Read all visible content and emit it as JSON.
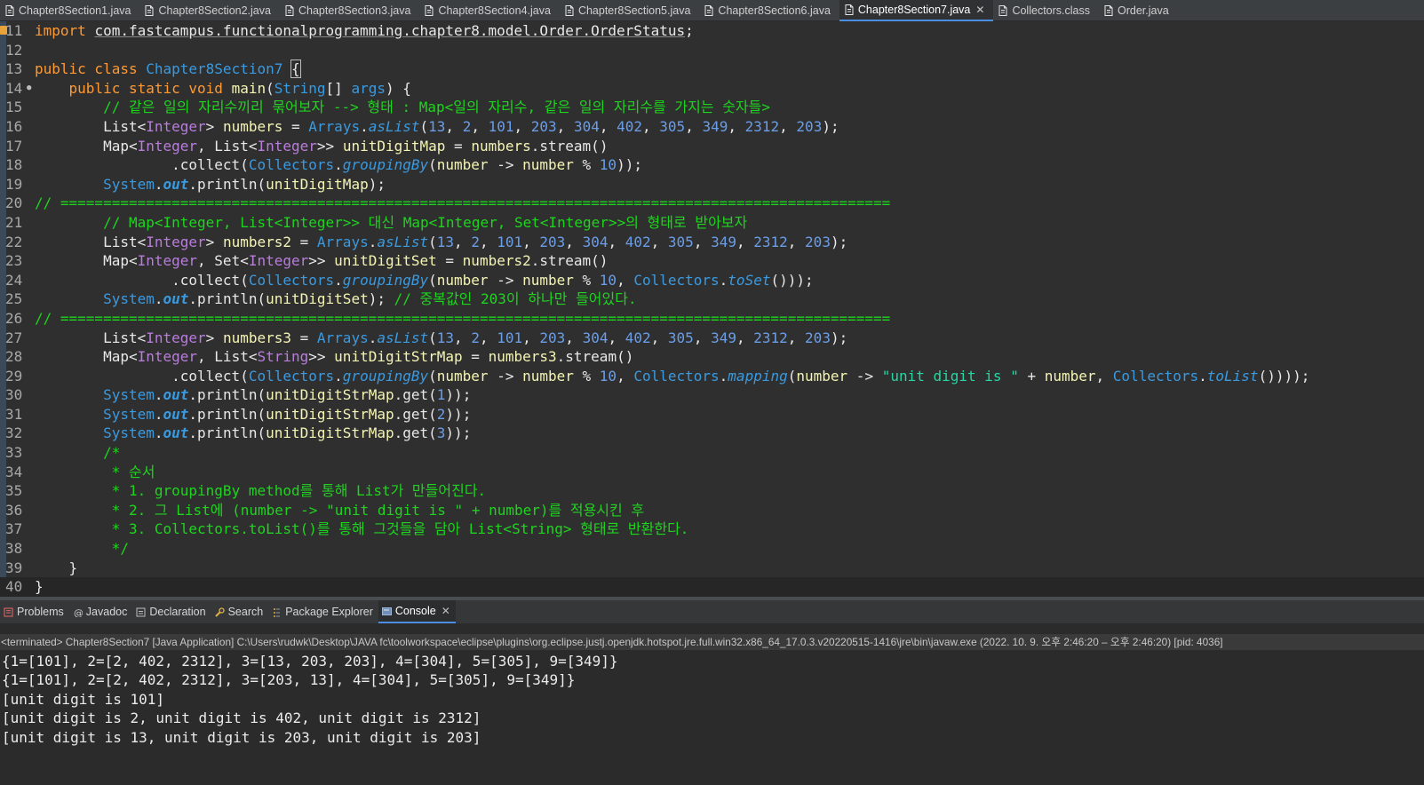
{
  "tabs": [
    {
      "label": "Chapter8Section1.java",
      "icon": "java-file-icon",
      "active": false
    },
    {
      "label": "Chapter8Section2.java",
      "icon": "java-file-icon",
      "active": false
    },
    {
      "label": "Chapter8Section3.java",
      "icon": "java-file-icon",
      "active": false
    },
    {
      "label": "Chapter8Section4.java",
      "icon": "java-file-icon",
      "active": false
    },
    {
      "label": "Chapter8Section5.java",
      "icon": "java-file-icon",
      "active": false
    },
    {
      "label": "Chapter8Section6.java",
      "icon": "java-file-icon",
      "active": false
    },
    {
      "label": "Chapter8Section7.java",
      "icon": "java-file-icon",
      "active": true,
      "close": "✕"
    },
    {
      "label": "Collectors.class",
      "icon": "class-file-icon",
      "active": false
    },
    {
      "label": "Order.java",
      "icon": "java-file-icon",
      "active": false
    }
  ],
  "editor": {
    "line_numbers": [
      "11",
      "12",
      "13",
      "14",
      "15",
      "16",
      "17",
      "18",
      "19",
      "20",
      "21",
      "22",
      "23",
      "24",
      "25",
      "26",
      "27",
      "28",
      "29",
      "30",
      "31",
      "32",
      "33",
      "34",
      "35",
      "36",
      "37",
      "38",
      "39",
      "40"
    ],
    "scroll_left_arrow": "<"
  },
  "panel": {
    "tabs": [
      {
        "label": "Problems",
        "icon": "problems-icon",
        "active": false
      },
      {
        "label": "Javadoc",
        "icon": "javadoc-icon",
        "active": false
      },
      {
        "label": "Declaration",
        "icon": "declaration-icon",
        "active": false
      },
      {
        "label": "Search",
        "icon": "search-icon",
        "active": false
      },
      {
        "label": "Package Explorer",
        "icon": "package-explorer-icon",
        "active": false
      },
      {
        "label": "Console",
        "icon": "console-icon",
        "active": true,
        "close": "✕"
      }
    ]
  },
  "console": {
    "header": "<terminated> Chapter8Section7 [Java Application] C:\\Users\\rudwk\\Desktop\\JAVA fc\\toolworkspace\\eclipse\\plugins\\org.eclipse.justj.openjdk.hotspot.jre.full.win32.x86_64_17.0.3.v20220515-1416\\jre\\bin\\javaw.exe  (2022. 10. 9. 오후 2:46:20 – 오후 2:46:20) [pid: 4036]",
    "output": [
      "{1=[101], 2=[2, 402, 2312], 3=[13, 203, 203], 4=[304], 5=[305], 9=[349]}",
      "{1=[101], 2=[2, 402, 2312], 3=[203, 13], 4=[304], 5=[305], 9=[349]}",
      "[unit digit is 101]",
      "[unit digit is 2, unit digit is 402, unit digit is 2312]",
      "[unit digit is 13, unit digit is 203, unit digit is 203]"
    ]
  },
  "code_lines": [
    [
      [
        "kw",
        "import "
      ],
      [
        "u",
        "com.fastcampus.functionalprogramming.chapter8.model.Order.OrderStatus"
      ],
      [
        "",
        "; "
      ]
    ],
    [],
    [
      [
        "kw",
        "public class "
      ],
      [
        "cls",
        "Chapter8Section7"
      ],
      [
        "",
        " "
      ],
      [
        "boxed",
        "{"
      ]
    ],
    [
      [
        "",
        "    "
      ],
      [
        "kw",
        "public static void "
      ],
      [
        "var",
        "main"
      ],
      [
        "",
        "("
      ],
      [
        "cls",
        "String"
      ],
      [
        "",
        "[] "
      ],
      [
        "cls",
        "args"
      ],
      [
        "",
        ") {"
      ]
    ],
    [
      [
        "",
        "        "
      ],
      [
        "cm",
        "// 같은 일의 자리수끼리 묶어보자 --> 형태 : Map<일의 자리수, 같은 일의 자리수를 가지는 숫자들>"
      ]
    ],
    [
      [
        "",
        "        List<"
      ],
      [
        "typ",
        "Integer"
      ],
      [
        "",
        "> "
      ],
      [
        "var",
        "numbers"
      ],
      [
        "",
        " = "
      ],
      [
        "cls",
        "Arrays"
      ],
      [
        "",
        "."
      ],
      [
        "cls it",
        "asList"
      ],
      [
        "",
        "("
      ],
      [
        "num",
        "13"
      ],
      [
        "",
        ", "
      ],
      [
        "num",
        "2"
      ],
      [
        "",
        ", "
      ],
      [
        "num",
        "101"
      ],
      [
        "",
        ", "
      ],
      [
        "num",
        "203"
      ],
      [
        "",
        ", "
      ],
      [
        "num",
        "304"
      ],
      [
        "",
        ", "
      ],
      [
        "num",
        "402"
      ],
      [
        "",
        ", "
      ],
      [
        "num",
        "305"
      ],
      [
        "",
        ", "
      ],
      [
        "num",
        "349"
      ],
      [
        "",
        ", "
      ],
      [
        "num",
        "2312"
      ],
      [
        "",
        ", "
      ],
      [
        "num",
        "203"
      ],
      [
        "",
        ");"
      ]
    ],
    [
      [
        "",
        "        Map<"
      ],
      [
        "typ",
        "Integer"
      ],
      [
        "",
        ", List<"
      ],
      [
        "typ",
        "Integer"
      ],
      [
        "",
        ">> "
      ],
      [
        "var",
        "unitDigitMap"
      ],
      [
        "",
        " = "
      ],
      [
        "var",
        "numbers"
      ],
      [
        "",
        ".stream()"
      ]
    ],
    [
      [
        "",
        "                .collect("
      ],
      [
        "cls",
        "Collectors"
      ],
      [
        "",
        "."
      ],
      [
        "cls it",
        "groupingBy"
      ],
      [
        "",
        "("
      ],
      [
        "var",
        "number"
      ],
      [
        "",
        " -> "
      ],
      [
        "var",
        "number"
      ],
      [
        "",
        " % "
      ],
      [
        "num",
        "10"
      ],
      [
        "",
        "));"
      ]
    ],
    [
      [
        "",
        "        "
      ],
      [
        "cls",
        "System"
      ],
      [
        "",
        "."
      ],
      [
        "cls it bold",
        "out"
      ],
      [
        "",
        ".println("
      ],
      [
        "var",
        "unitDigitMap"
      ],
      [
        "",
        ");"
      ]
    ],
    [
      [
        "cm",
        "// ================================================================================================="
      ]
    ],
    [
      [
        "",
        "        "
      ],
      [
        "cm",
        "// Map<Integer, List<Integer>> 대신 Map<Integer, Set<Integer>>의 형태로 받아보자"
      ]
    ],
    [
      [
        "",
        "        List<"
      ],
      [
        "typ",
        "Integer"
      ],
      [
        "",
        "> "
      ],
      [
        "var",
        "numbers2"
      ],
      [
        "",
        " = "
      ],
      [
        "cls",
        "Arrays"
      ],
      [
        "",
        "."
      ],
      [
        "cls it",
        "asList"
      ],
      [
        "",
        "("
      ],
      [
        "num",
        "13"
      ],
      [
        "",
        ", "
      ],
      [
        "num",
        "2"
      ],
      [
        "",
        ", "
      ],
      [
        "num",
        "101"
      ],
      [
        "",
        ", "
      ],
      [
        "num",
        "203"
      ],
      [
        "",
        ", "
      ],
      [
        "num",
        "304"
      ],
      [
        "",
        ", "
      ],
      [
        "num",
        "402"
      ],
      [
        "",
        ", "
      ],
      [
        "num",
        "305"
      ],
      [
        "",
        ", "
      ],
      [
        "num",
        "349"
      ],
      [
        "",
        ", "
      ],
      [
        "num",
        "2312"
      ],
      [
        "",
        ", "
      ],
      [
        "num",
        "203"
      ],
      [
        "",
        ");"
      ]
    ],
    [
      [
        "",
        "        Map<"
      ],
      [
        "typ",
        "Integer"
      ],
      [
        "",
        ", Set<"
      ],
      [
        "typ",
        "Integer"
      ],
      [
        "",
        ">> "
      ],
      [
        "var",
        "unitDigitSet"
      ],
      [
        "",
        " = "
      ],
      [
        "var",
        "numbers2"
      ],
      [
        "",
        ".stream()"
      ]
    ],
    [
      [
        "",
        "                .collect("
      ],
      [
        "cls",
        "Collectors"
      ],
      [
        "",
        "."
      ],
      [
        "cls it",
        "groupingBy"
      ],
      [
        "",
        "("
      ],
      [
        "var",
        "number"
      ],
      [
        "",
        " -> "
      ],
      [
        "var",
        "number"
      ],
      [
        "",
        " % "
      ],
      [
        "num",
        "10"
      ],
      [
        "",
        ", "
      ],
      [
        "cls",
        "Collectors"
      ],
      [
        "",
        "."
      ],
      [
        "cls it",
        "toSet"
      ],
      [
        "",
        "()));"
      ]
    ],
    [
      [
        "",
        "        "
      ],
      [
        "cls",
        "System"
      ],
      [
        "",
        "."
      ],
      [
        "cls it bold",
        "out"
      ],
      [
        "",
        ".println("
      ],
      [
        "var",
        "unitDigitSet"
      ],
      [
        "",
        "); "
      ],
      [
        "cm",
        "// 중복값인 203이 하나만 들어있다."
      ]
    ],
    [
      [
        "cm",
        "// ================================================================================================="
      ]
    ],
    [
      [
        "",
        "        List<"
      ],
      [
        "typ",
        "Integer"
      ],
      [
        "",
        "> "
      ],
      [
        "var",
        "numbers3"
      ],
      [
        "",
        " = "
      ],
      [
        "cls",
        "Arrays"
      ],
      [
        "",
        "."
      ],
      [
        "cls it",
        "asList"
      ],
      [
        "",
        "("
      ],
      [
        "num",
        "13"
      ],
      [
        "",
        ", "
      ],
      [
        "num",
        "2"
      ],
      [
        "",
        ", "
      ],
      [
        "num",
        "101"
      ],
      [
        "",
        ", "
      ],
      [
        "num",
        "203"
      ],
      [
        "",
        ", "
      ],
      [
        "num",
        "304"
      ],
      [
        "",
        ", "
      ],
      [
        "num",
        "402"
      ],
      [
        "",
        ", "
      ],
      [
        "num",
        "305"
      ],
      [
        "",
        ", "
      ],
      [
        "num",
        "349"
      ],
      [
        "",
        ", "
      ],
      [
        "num",
        "2312"
      ],
      [
        "",
        ", "
      ],
      [
        "num",
        "203"
      ],
      [
        "",
        ");"
      ]
    ],
    [
      [
        "",
        "        Map<"
      ],
      [
        "typ",
        "Integer"
      ],
      [
        "",
        ", List<"
      ],
      [
        "typ",
        "String"
      ],
      [
        "",
        ">> "
      ],
      [
        "var",
        "unitDigitStrMap"
      ],
      [
        "",
        " = "
      ],
      [
        "var",
        "numbers3"
      ],
      [
        "",
        ".stream()"
      ]
    ],
    [
      [
        "",
        "                .collect("
      ],
      [
        "cls",
        "Collectors"
      ],
      [
        "",
        "."
      ],
      [
        "cls it",
        "groupingBy"
      ],
      [
        "",
        "("
      ],
      [
        "var",
        "number"
      ],
      [
        "",
        " -> "
      ],
      [
        "var",
        "number"
      ],
      [
        "",
        " % "
      ],
      [
        "num",
        "10"
      ],
      [
        "",
        ", "
      ],
      [
        "cls",
        "Collectors"
      ],
      [
        "",
        "."
      ],
      [
        "cls it",
        "mapping"
      ],
      [
        "",
        "("
      ],
      [
        "var",
        "number"
      ],
      [
        "",
        " -> "
      ],
      [
        "str",
        "\"unit digit is \""
      ],
      [
        "",
        " + "
      ],
      [
        "var",
        "number"
      ],
      [
        "",
        ", "
      ],
      [
        "cls",
        "Collectors"
      ],
      [
        "",
        "."
      ],
      [
        "cls it",
        "toList"
      ],
      [
        "",
        "())));"
      ]
    ],
    [
      [
        "",
        "        "
      ],
      [
        "cls",
        "System"
      ],
      [
        "",
        "."
      ],
      [
        "cls it bold",
        "out"
      ],
      [
        "",
        ".println("
      ],
      [
        "var",
        "unitDigitStrMap"
      ],
      [
        "",
        ".get("
      ],
      [
        "num",
        "1"
      ],
      [
        "",
        "));"
      ]
    ],
    [
      [
        "",
        "        "
      ],
      [
        "cls",
        "System"
      ],
      [
        "",
        "."
      ],
      [
        "cls it bold",
        "out"
      ],
      [
        "",
        ".println("
      ],
      [
        "var",
        "unitDigitStrMap"
      ],
      [
        "",
        ".get("
      ],
      [
        "num",
        "2"
      ],
      [
        "",
        "));"
      ]
    ],
    [
      [
        "",
        "        "
      ],
      [
        "cls",
        "System"
      ],
      [
        "",
        "."
      ],
      [
        "cls it bold",
        "out"
      ],
      [
        "",
        ".println("
      ],
      [
        "var",
        "unitDigitStrMap"
      ],
      [
        "",
        ".get("
      ],
      [
        "num",
        "3"
      ],
      [
        "",
        "));"
      ]
    ],
    [
      [
        "",
        "        "
      ],
      [
        "cm",
        "/*"
      ]
    ],
    [
      [
        "",
        "         "
      ],
      [
        "cm",
        "* 순서"
      ]
    ],
    [
      [
        "",
        "         "
      ],
      [
        "cm",
        "* 1. groupingBy method를 통해 List가 만들어진다."
      ]
    ],
    [
      [
        "",
        "         "
      ],
      [
        "cm",
        "* 2. 그 List에 (number -> \"unit digit is \" + number)를 적용시킨 후"
      ]
    ],
    [
      [
        "",
        "         "
      ],
      [
        "cm",
        "* 3. Collectors.toList()를 통해 그것들을 담아 List<String> 형태로 반환한다."
      ]
    ],
    [
      [
        "",
        "         "
      ],
      [
        "cm",
        "*/"
      ]
    ],
    [
      [
        "",
        "    }"
      ]
    ],
    [
      [
        "",
        "}"
      ]
    ]
  ]
}
